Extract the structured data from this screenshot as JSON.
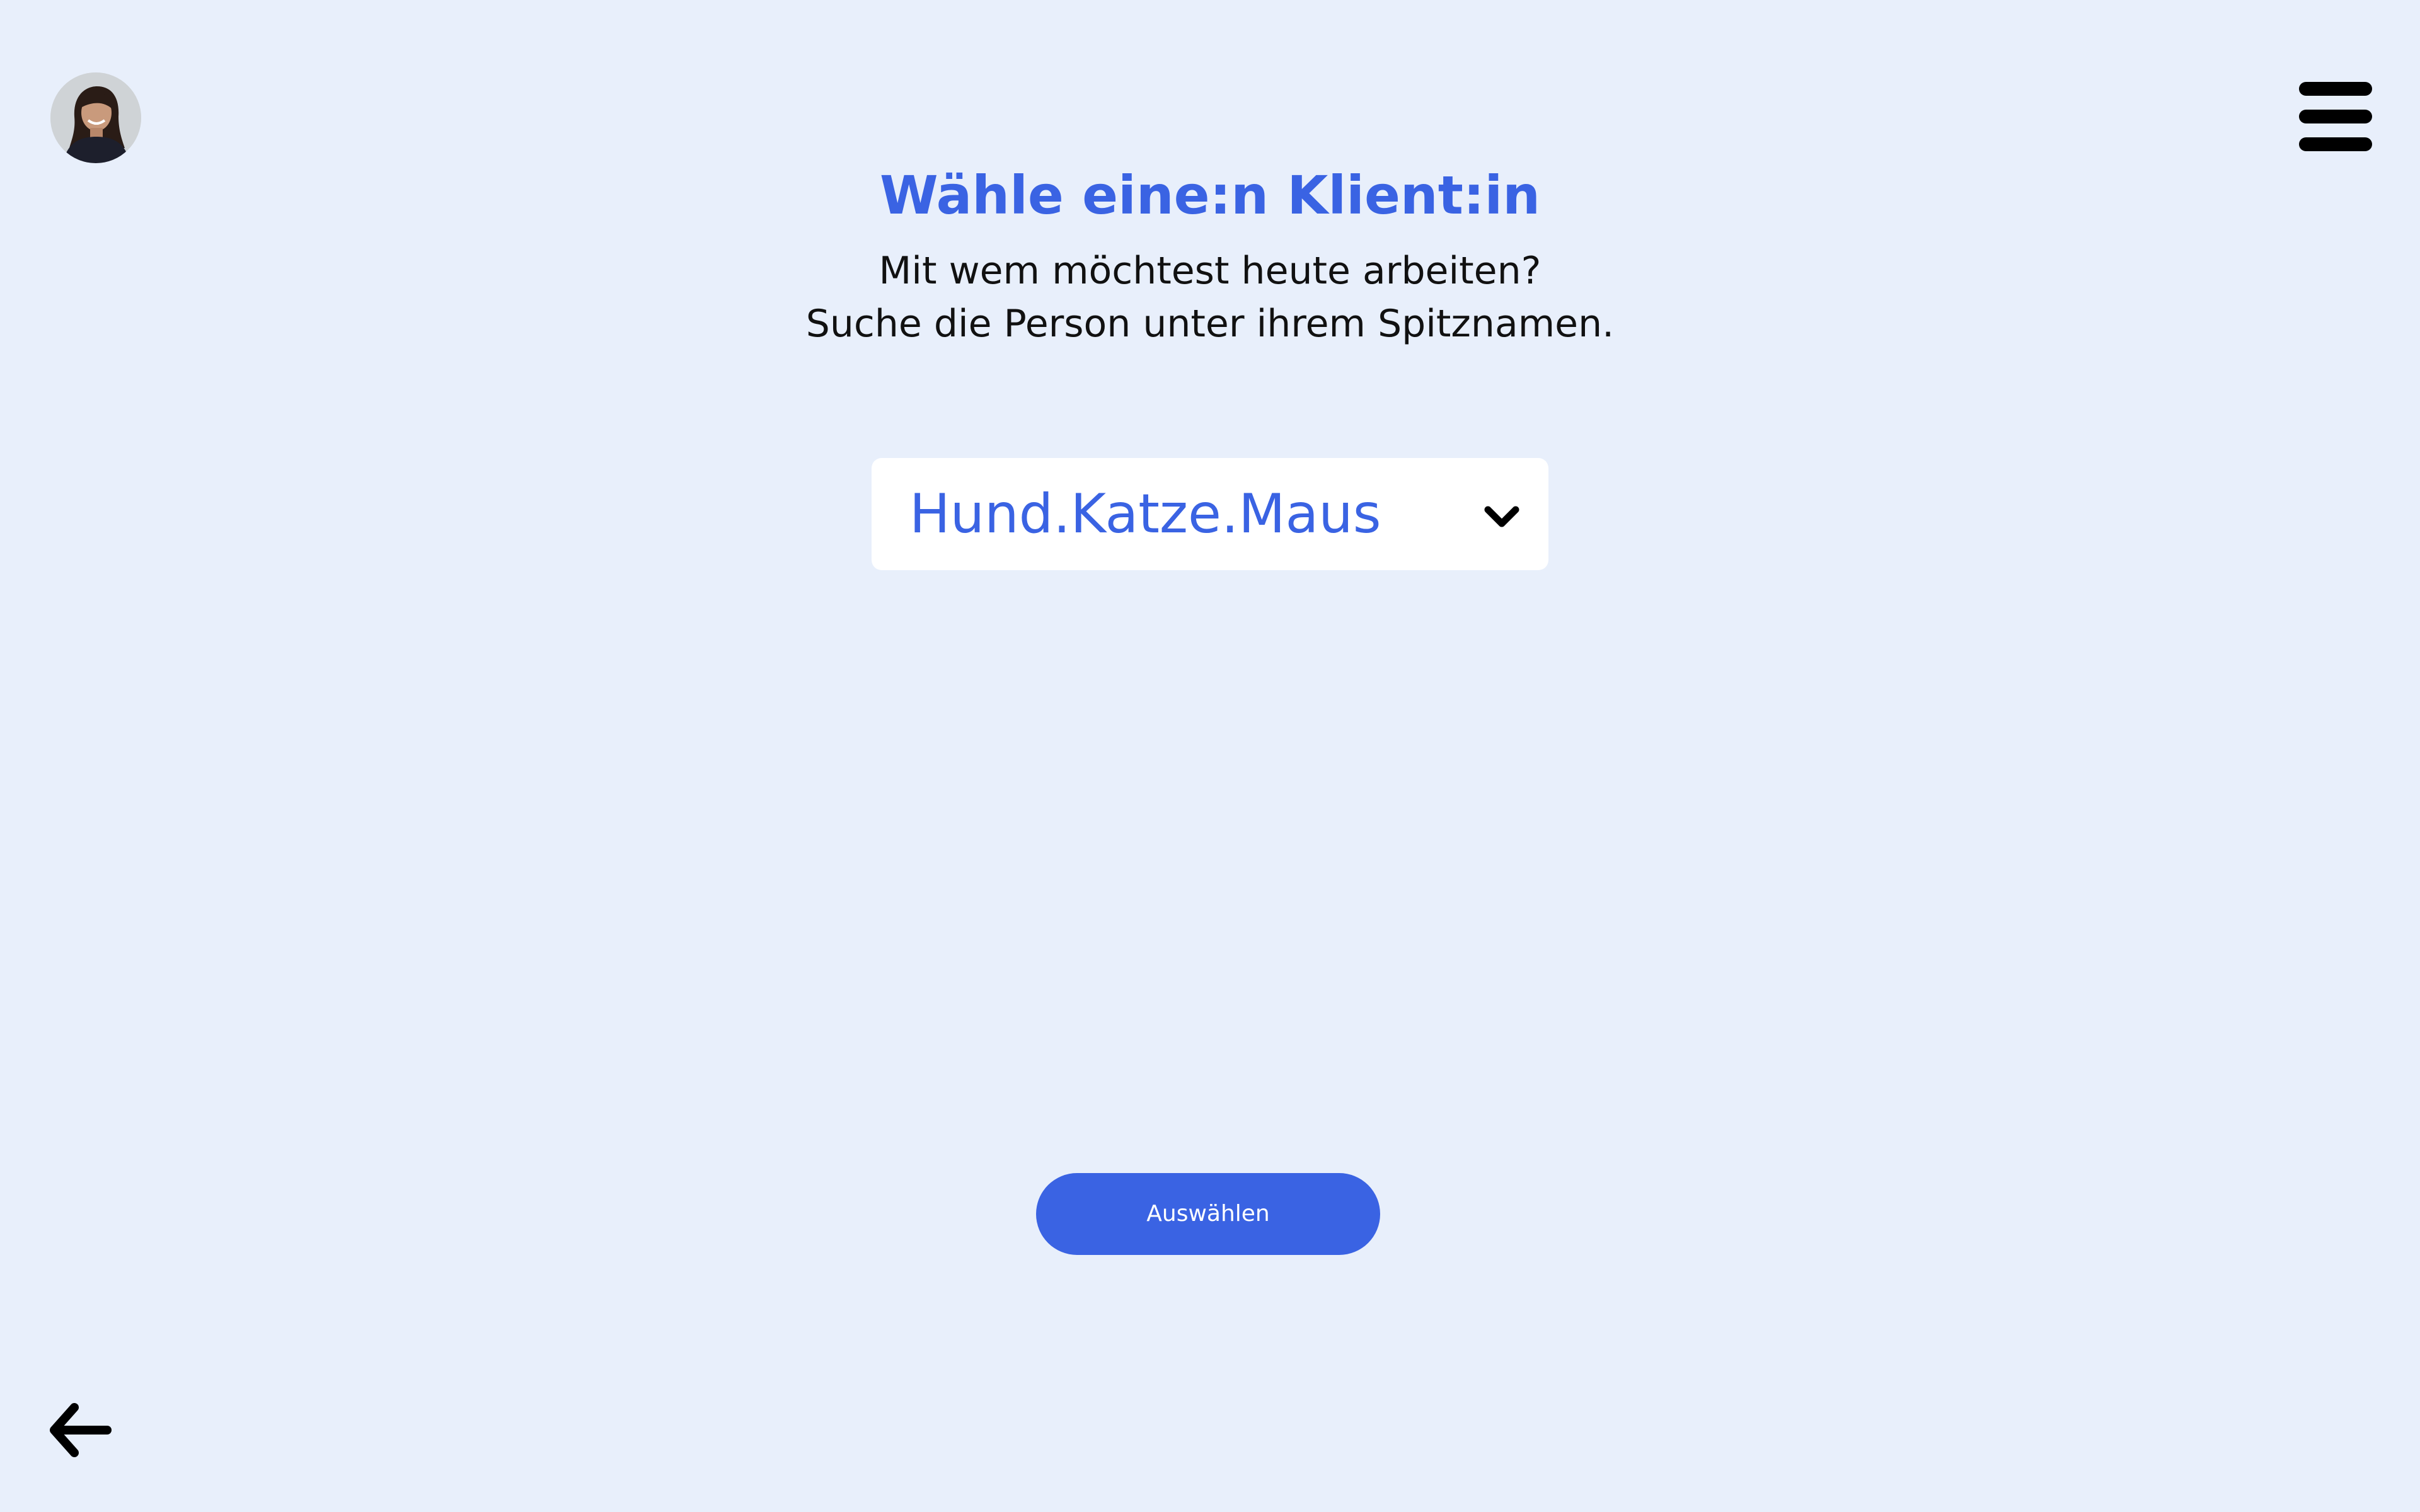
{
  "header": {
    "avatar_icon": "user-avatar",
    "menu_icon": "hamburger-menu-icon"
  },
  "main": {
    "title": "Wähle eine:n Klient:in",
    "subtitle_line1": "Mit wem möchtest heute arbeiten?",
    "subtitle_line2": "Suche die Person unter ihrem Spitznamen.",
    "client_select": {
      "selected_value": "Hund.Katze.Maus",
      "icon": "chevron-down-icon"
    },
    "submit_label": "Auswählen"
  },
  "footer": {
    "back_icon": "arrow-left-icon"
  },
  "colors": {
    "background": "#e8effb",
    "accent": "#3a63e3",
    "text": "#111111",
    "card": "#ffffff"
  }
}
